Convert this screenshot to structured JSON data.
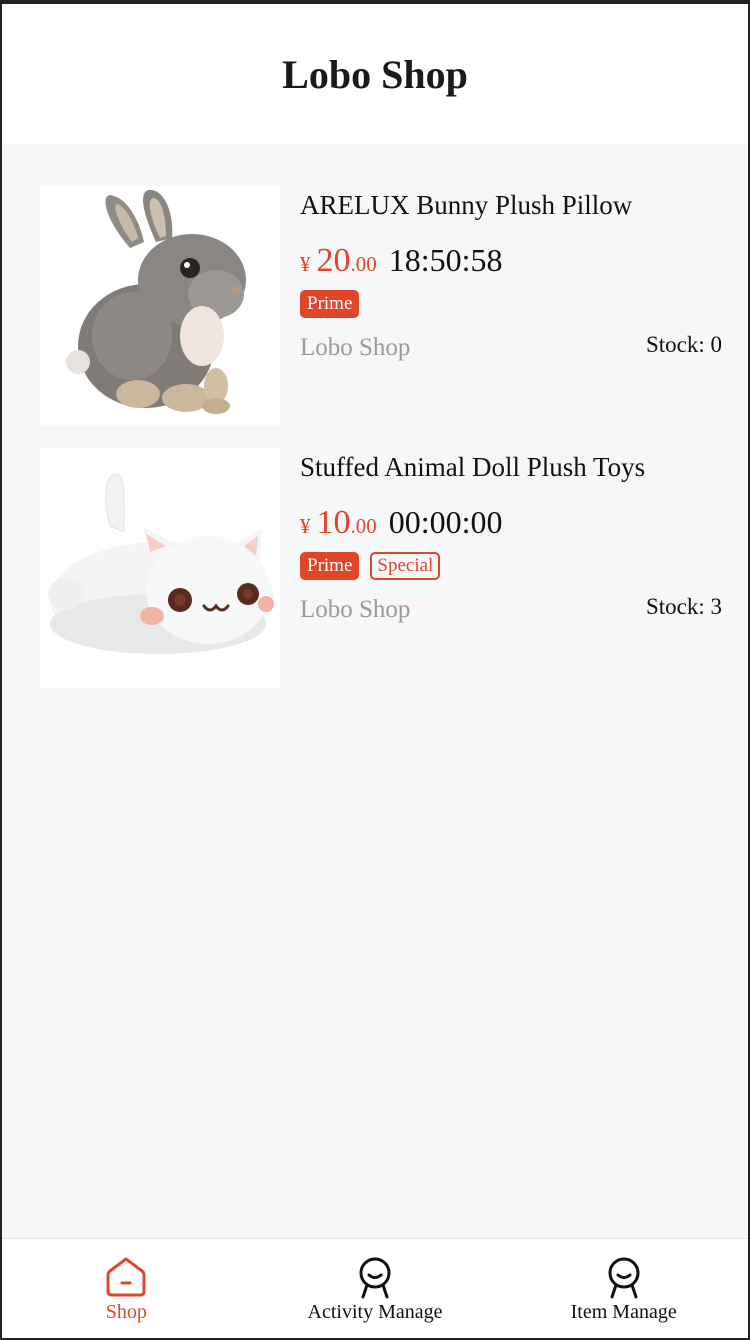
{
  "header": {
    "title": "Lobo Shop"
  },
  "products": [
    {
      "title": "ARELUX Bunny Plush Pillow",
      "currency": "¥",
      "price_int": "20",
      "price_dec": ".00",
      "countdown": "18:50:58",
      "tags": [
        "Prime"
      ],
      "seller": "Lobo Shop",
      "stock": "Stock: 0",
      "image": "gray-bunny-plush"
    },
    {
      "title": "Stuffed Animal Doll Plush Toys",
      "currency": "¥",
      "price_int": "10",
      "price_dec": ".00",
      "countdown": "00:00:00",
      "tags": [
        "Prime",
        "Special"
      ],
      "seller": "Lobo Shop",
      "stock": "Stock: 3",
      "image": "white-cat-plush"
    }
  ],
  "tabbar": {
    "items": [
      {
        "label": "Shop",
        "icon": "home-icon",
        "active": true
      },
      {
        "label": "Activity Manage",
        "icon": "person-icon",
        "active": false
      },
      {
        "label": "Item Manage",
        "icon": "person-icon",
        "active": false
      }
    ]
  },
  "colors": {
    "accent": "#e0462a",
    "background": "#f6f7f9",
    "muted": "#9a9a9a"
  }
}
